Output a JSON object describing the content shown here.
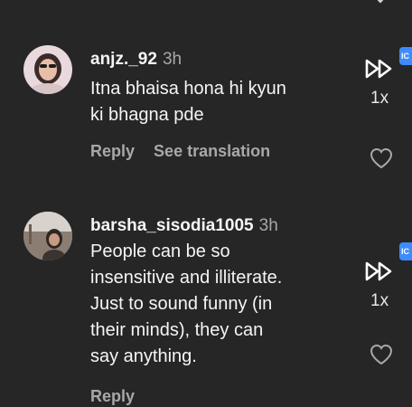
{
  "comments": [
    {
      "username": "anjz._92",
      "time": "3h",
      "text_lines": [
        "Itna bhaisa hona hi kyun",
        "ki bhagna pde"
      ],
      "actions": [
        "Reply",
        "See translation"
      ],
      "speed": "1x",
      "side_tag": "IC",
      "avatar_icon": "avatar-photo-woman",
      "like_icon": "heart-outline-icon"
    },
    {
      "username": "barsha_sisodia1005",
      "time": "3h",
      "text_lines": [
        "People can be so",
        "insensitive and illiterate.",
        "Just to sound funny (in",
        "their minds), they can",
        "say anything."
      ],
      "actions": [
        "Reply"
      ],
      "speed": "1x",
      "side_tag": "IC",
      "avatar_icon": "avatar-photo-outdoor",
      "like_icon": "heart-outline-icon"
    }
  ],
  "colors": {
    "background": "#262626",
    "text_primary": "#f5f5f5",
    "text_secondary": "#a8a8a8",
    "tag_blue": "#3d8bff"
  }
}
